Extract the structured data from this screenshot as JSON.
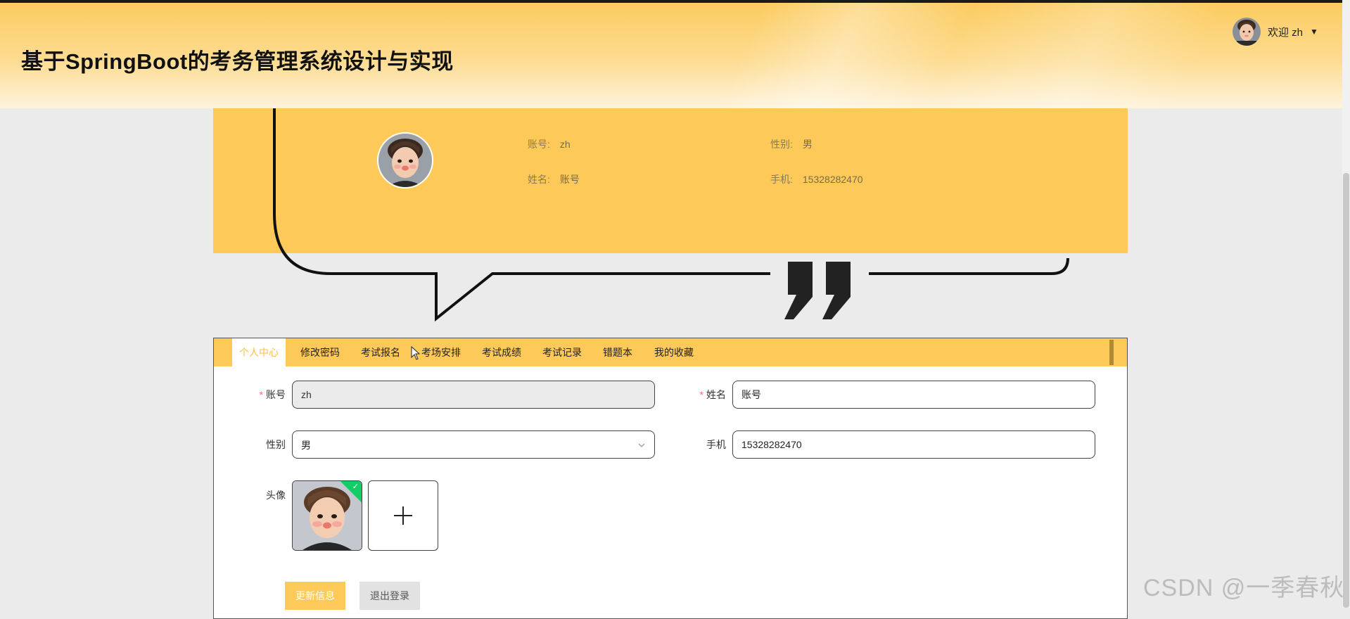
{
  "header": {
    "title": "基于SpringBoot的考务管理系统设计与实现",
    "welcome": "欢迎 zh"
  },
  "profile": {
    "account_label": "账号:",
    "account_value": "zh",
    "gender_label": "性别:",
    "gender_value": "男",
    "name_label": "姓名:",
    "name_value": "账号",
    "phone_label": "手机:",
    "phone_value": "15328282470"
  },
  "tabs": [
    {
      "label": "个人中心",
      "active": true
    },
    {
      "label": "修改密码",
      "active": false
    },
    {
      "label": "考试报名",
      "active": false
    },
    {
      "label": "考场安排",
      "active": false
    },
    {
      "label": "考试成绩",
      "active": false
    },
    {
      "label": "考试记录",
      "active": false
    },
    {
      "label": "错题本",
      "active": false
    },
    {
      "label": "我的收藏",
      "active": false
    }
  ],
  "form": {
    "account_label": "账号",
    "account_value": "zh",
    "name_label": "姓名",
    "name_value": "账号",
    "gender_label": "性别",
    "gender_value": "男",
    "phone_label": "手机",
    "phone_value": "15328282470",
    "avatar_label": "头像",
    "required_mark": "*"
  },
  "buttons": {
    "update": "更新信息",
    "logout": "退出登录"
  },
  "watermark": "CSDN @一季春秋",
  "colors": {
    "accent": "#fdca5a",
    "active_tab_text": "#fcc04b",
    "upload_success": "#13ce66"
  },
  "icons": {
    "caret": "caret-down-icon",
    "chevron": "chevron-down-icon",
    "plus": "plus-icon",
    "check": "check-icon",
    "quote": "quote-icon"
  }
}
